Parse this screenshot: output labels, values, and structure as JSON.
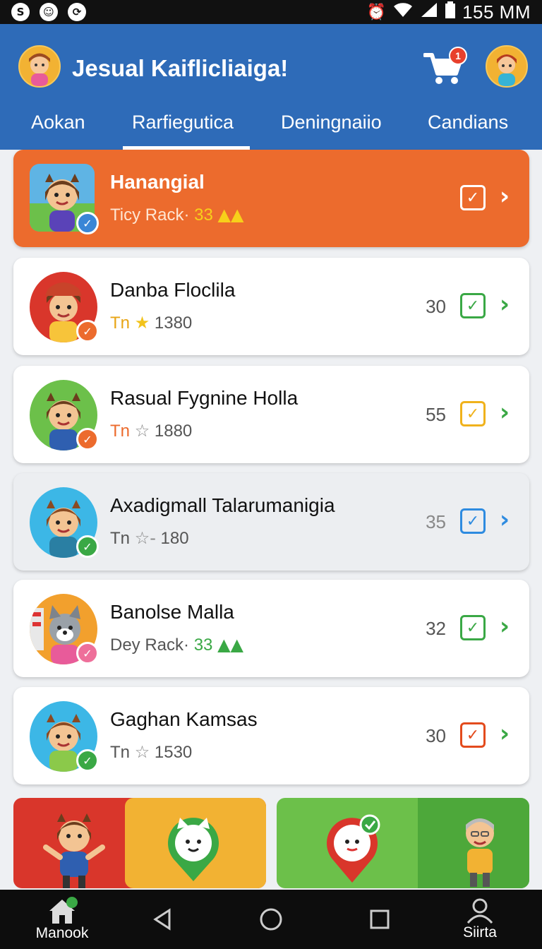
{
  "status_bar": {
    "left_icons": [
      "s-icon",
      "chat-bubble-icon",
      "sync-icon"
    ],
    "time": "155 MM"
  },
  "header": {
    "title": "Jesual Kaiflicliaiga!",
    "cart_badge": "1",
    "tabs": [
      {
        "label": "Aokan",
        "active": false
      },
      {
        "label": "Rarfiegutica",
        "active": true
      },
      {
        "label": "Deningnaiio",
        "active": false
      },
      {
        "label": "Candians",
        "active": false
      }
    ]
  },
  "list": {
    "items": [
      {
        "name": "Hanangial",
        "sub_prefix": "Ticy Rack·",
        "sub_value": "33",
        "count": "",
        "box_color": "#ffffff",
        "check_color": "#3a86d6",
        "style": "highlight"
      },
      {
        "name": "Danba Floclila",
        "sub_prefix": "Tn",
        "sub_value": "1380",
        "count": "30",
        "box_color": "#3aa845",
        "check_color": "#ec6b2d",
        "style": "normal"
      },
      {
        "name": "Rasual Fygnine Holla",
        "sub_prefix": "Tn",
        "sub_value": "1880",
        "count": "55",
        "box_color": "#f0b21c",
        "check_color": "#ec6b2d",
        "style": "normal"
      },
      {
        "name": "Axadigmall Talarumanigia",
        "sub_prefix": "Tn",
        "sub_value": "180",
        "count": "35",
        "box_color": "#2e8be0",
        "check_color": "#3aa845",
        "style": "grey"
      },
      {
        "name": "Banolse Malla",
        "sub_prefix": "Dey Rack·",
        "sub_value": "33",
        "count": "32",
        "box_color": "#3aa845",
        "check_color": "#ee6f9a",
        "style": "normal"
      },
      {
        "name": "Gaghan Kamsas",
        "sub_prefix": "Tn",
        "sub_value": "1530",
        "count": "30",
        "box_color": "#e34b1d",
        "check_color": "#3aa845",
        "style": "normal"
      }
    ]
  },
  "bottom_nav": {
    "home_label": "Manook",
    "profile_label": "Siirta"
  },
  "colors": {
    "header": "#2e6bb8",
    "highlight_card": "#ec6b2d"
  }
}
